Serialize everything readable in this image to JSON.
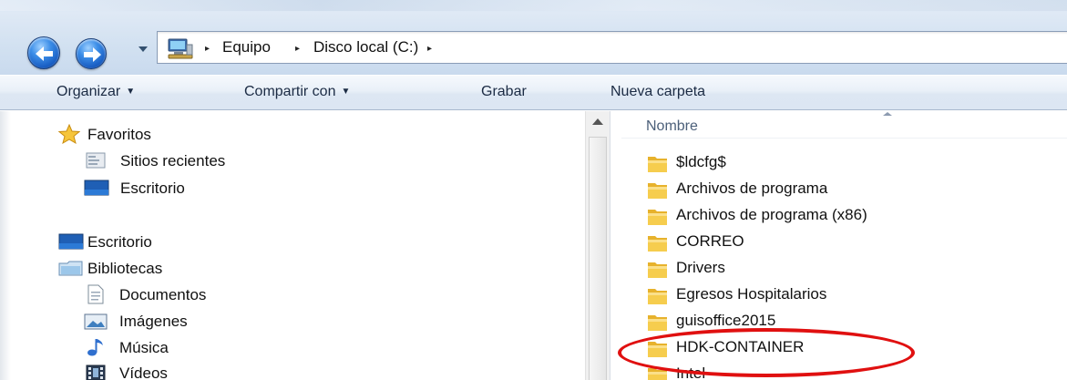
{
  "address_bar": {
    "breadcrumbs": [
      "Equipo",
      "Disco local (C:)"
    ],
    "separator": "▸"
  },
  "command_bar": {
    "organize": "Organizar",
    "share": "Compartir con",
    "burn": "Grabar",
    "new_folder": "Nueva carpeta"
  },
  "nav_pane": {
    "favorites": "Favoritos",
    "recent": "Sitios recientes",
    "desktop_fav": "Escritorio",
    "desktop": "Escritorio",
    "libraries": "Bibliotecas",
    "documents": "Documentos",
    "images": "Imágenes",
    "music": "Música",
    "videos": "Vídeos"
  },
  "file_list": {
    "column_name": "Nombre",
    "items": [
      "$ldcfg$",
      "Archivos de programa",
      "Archivos de programa (x86)",
      "CORREO",
      "Drivers",
      "Egresos Hospitalarios",
      "guisoffice2015",
      "HDK-CONTAINER",
      "Intel"
    ]
  },
  "colors": {
    "highlight": "#e01010",
    "folder": "#f2c23a"
  }
}
